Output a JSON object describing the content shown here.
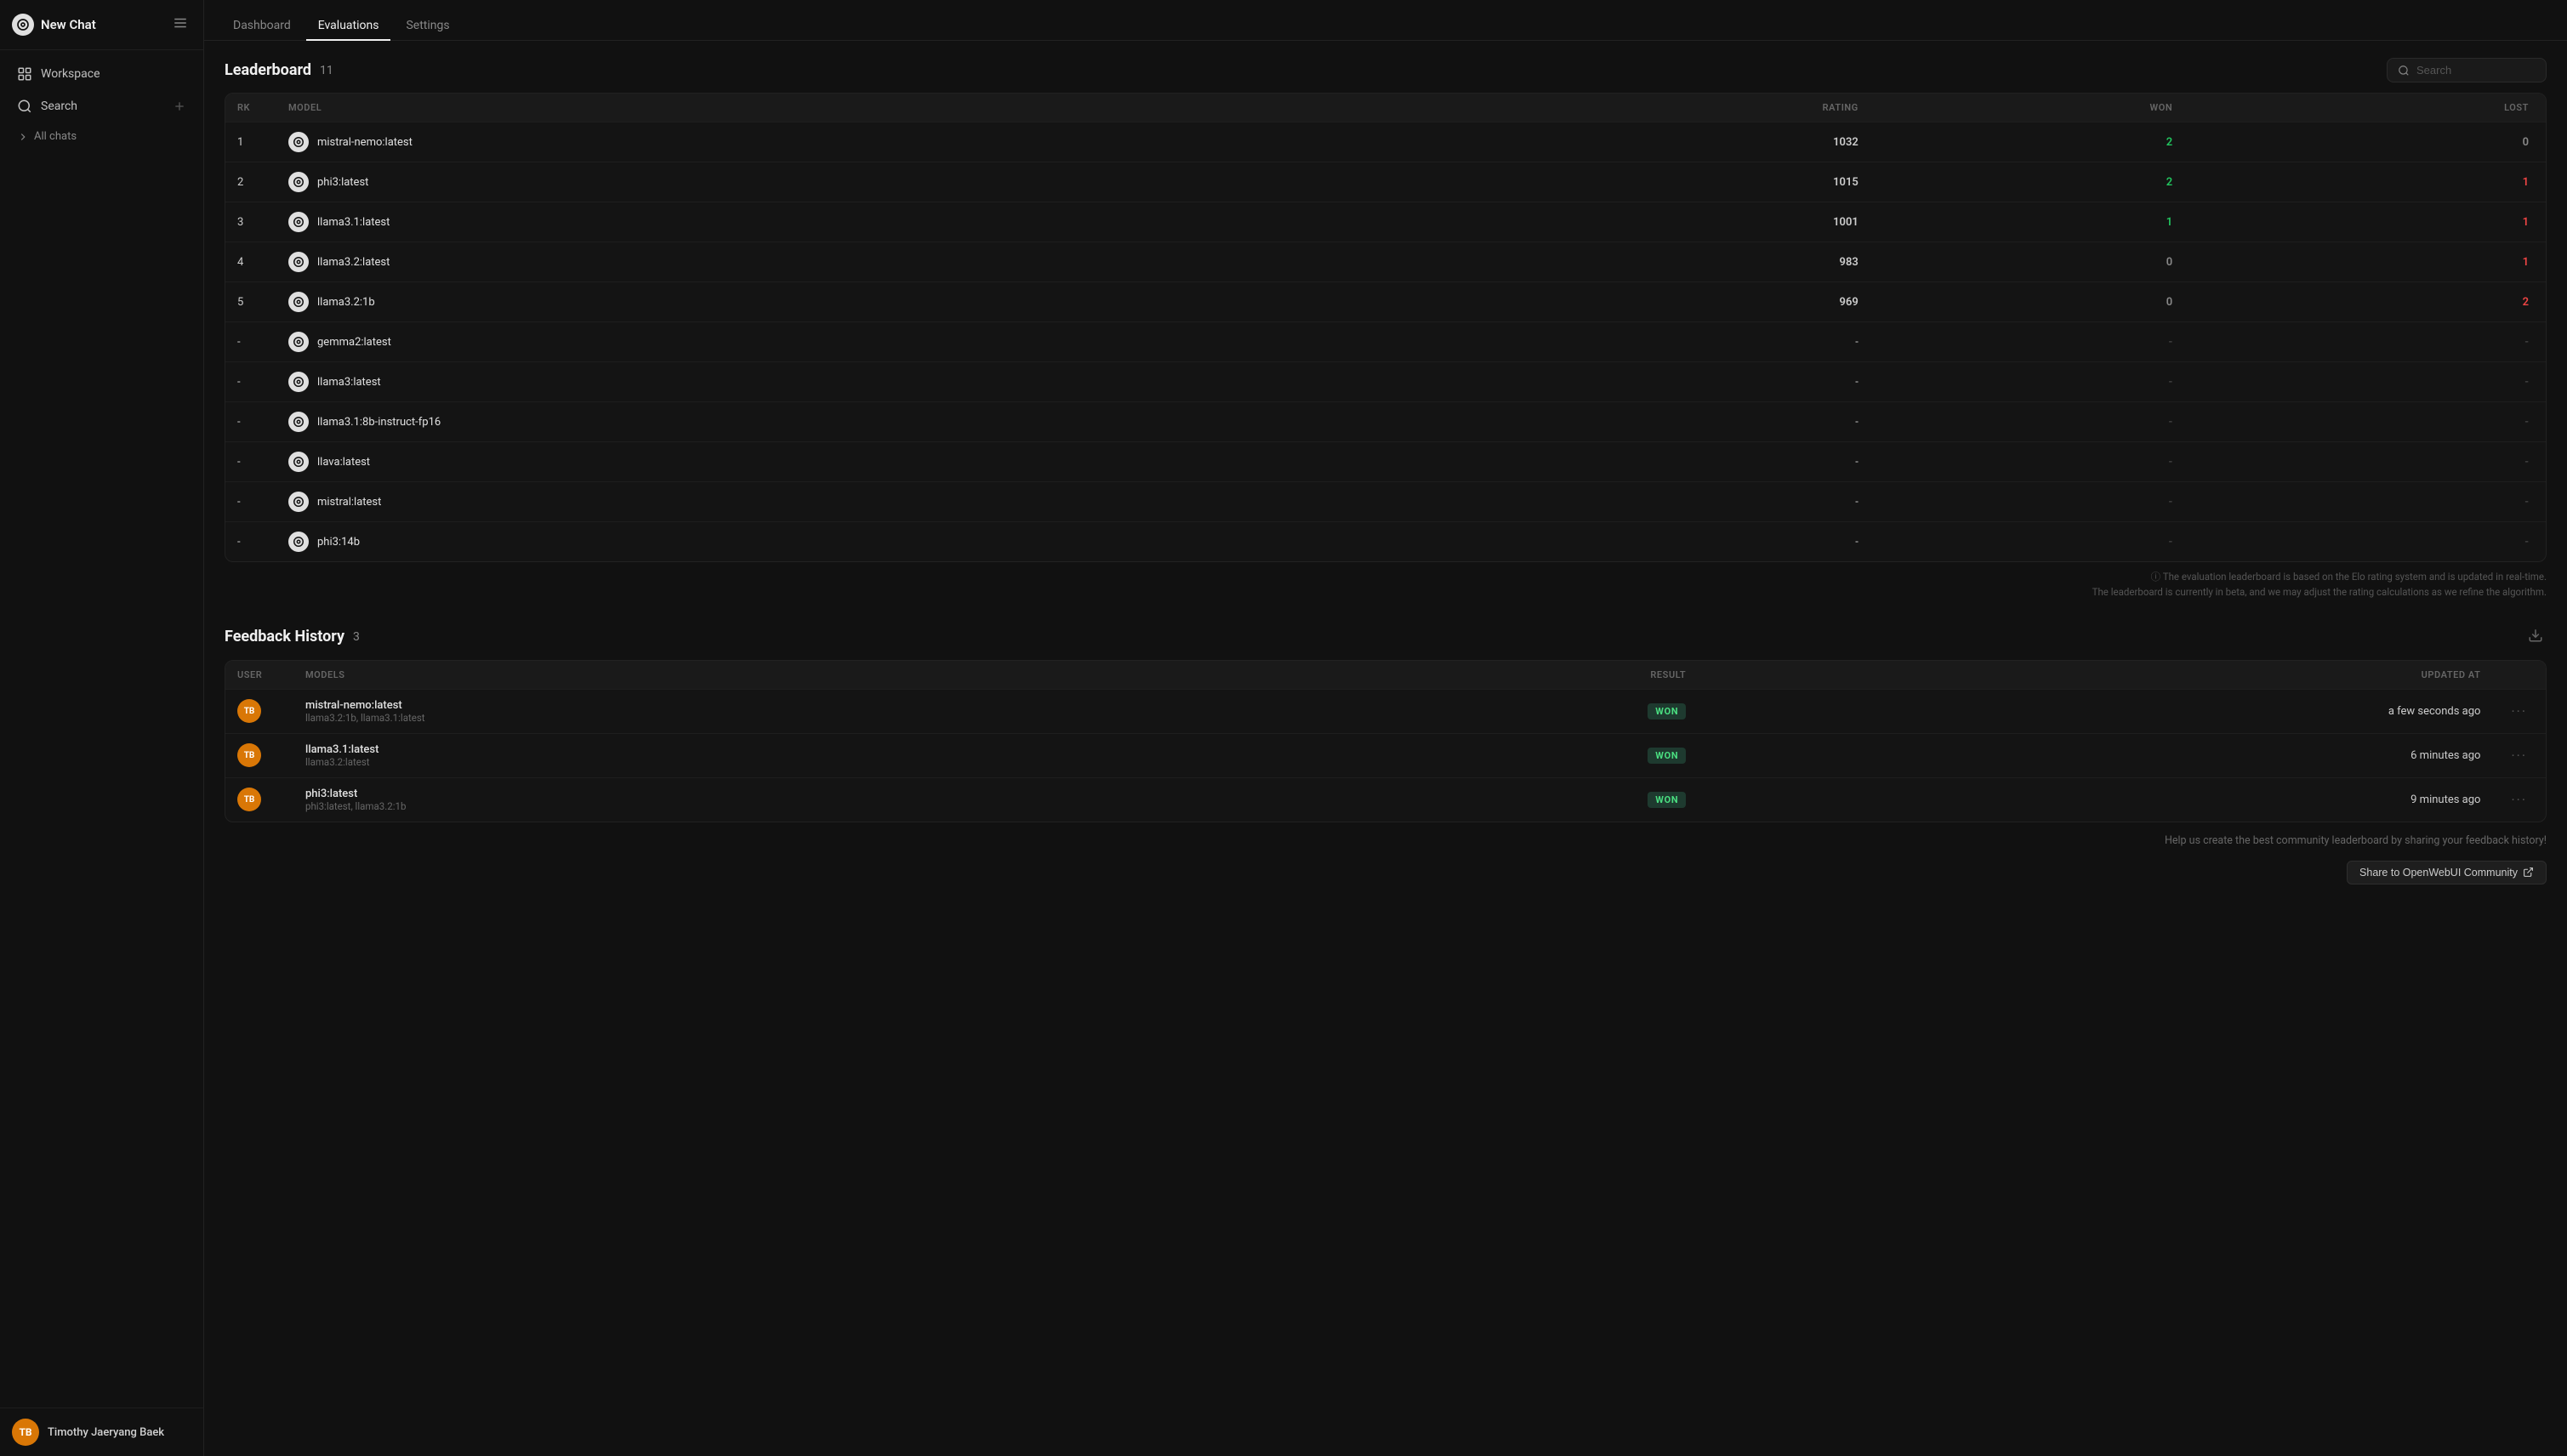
{
  "sidebar": {
    "logo_label": "New Chat",
    "workspace_label": "Workspace",
    "search_label": "Search",
    "all_chats_label": "All chats",
    "user_initials": "TB",
    "user_name": "Timothy Jaeryang Baek"
  },
  "top_nav": {
    "tabs": [
      {
        "id": "dashboard",
        "label": "Dashboard",
        "active": false
      },
      {
        "id": "evaluations",
        "label": "Evaluations",
        "active": true
      },
      {
        "id": "settings",
        "label": "Settings",
        "active": false
      }
    ]
  },
  "leaderboard": {
    "title": "Leaderboard",
    "count": "11",
    "search_placeholder": "Search",
    "columns": [
      "RK",
      "MODEL",
      "RATING",
      "WON",
      "LOST"
    ],
    "rows": [
      {
        "rank": "1",
        "model": "mistral-nemo:latest",
        "rating": "1032",
        "won": "2",
        "lost": "0",
        "won_color": "green",
        "lost_color": "normal"
      },
      {
        "rank": "2",
        "model": "phi3:latest",
        "rating": "1015",
        "won": "2",
        "lost": "1",
        "won_color": "green",
        "lost_color": "red"
      },
      {
        "rank": "3",
        "model": "llama3.1:latest",
        "rating": "1001",
        "won": "1",
        "lost": "1",
        "won_color": "green",
        "lost_color": "red"
      },
      {
        "rank": "4",
        "model": "llama3.2:latest",
        "rating": "983",
        "won": "0",
        "lost": "1",
        "won_color": "normal",
        "lost_color": "red"
      },
      {
        "rank": "5",
        "model": "llama3.2:1b",
        "rating": "969",
        "won": "0",
        "lost": "2",
        "won_color": "normal",
        "lost_color": "red"
      },
      {
        "rank": "-",
        "model": "gemma2:latest",
        "rating": "-",
        "won": "-",
        "lost": "-",
        "won_color": "dash",
        "lost_color": "dash"
      },
      {
        "rank": "-",
        "model": "llama3:latest",
        "rating": "-",
        "won": "-",
        "lost": "-",
        "won_color": "dash",
        "lost_color": "dash"
      },
      {
        "rank": "-",
        "model": "llama3.1:8b-instruct-fp16",
        "rating": "-",
        "won": "-",
        "lost": "-",
        "won_color": "dash",
        "lost_color": "dash"
      },
      {
        "rank": "-",
        "model": "llava:latest",
        "rating": "-",
        "won": "-",
        "lost": "-",
        "won_color": "dash",
        "lost_color": "dash"
      },
      {
        "rank": "-",
        "model": "mistral:latest",
        "rating": "-",
        "won": "-",
        "lost": "-",
        "won_color": "dash",
        "lost_color": "dash"
      },
      {
        "rank": "-",
        "model": "phi3:14b",
        "rating": "-",
        "won": "-",
        "lost": "-",
        "won_color": "dash",
        "lost_color": "dash"
      }
    ],
    "info_note_1": "ⓘ The evaluation leaderboard is based on the Elo rating system and is updated in real-time.",
    "info_note_2": "The leaderboard is currently in beta, and we may adjust the rating calculations as we refine the algorithm."
  },
  "feedback_history": {
    "title": "Feedback History",
    "count": "3",
    "columns": [
      "USER",
      "MODELS",
      "RESULT",
      "UPDATED AT"
    ],
    "rows": [
      {
        "user_initials": "TB",
        "winner": "mistral-nemo:latest",
        "loser": "llama3.2:1b, llama3.1:latest",
        "result": "WON",
        "updated_at": "a few seconds ago"
      },
      {
        "user_initials": "TB",
        "winner": "llama3.1:latest",
        "loser": "llama3.2:latest",
        "result": "WON",
        "updated_at": "6 minutes ago"
      },
      {
        "user_initials": "TB",
        "winner": "phi3:latest",
        "loser": "phi3:latest, llama3.2:1b",
        "result": "WON",
        "updated_at": "9 minutes ago"
      }
    ],
    "community_note": "Help us create the best community leaderboard by sharing your feedback history!",
    "share_button_label": "Share to OpenWebUI Community"
  }
}
